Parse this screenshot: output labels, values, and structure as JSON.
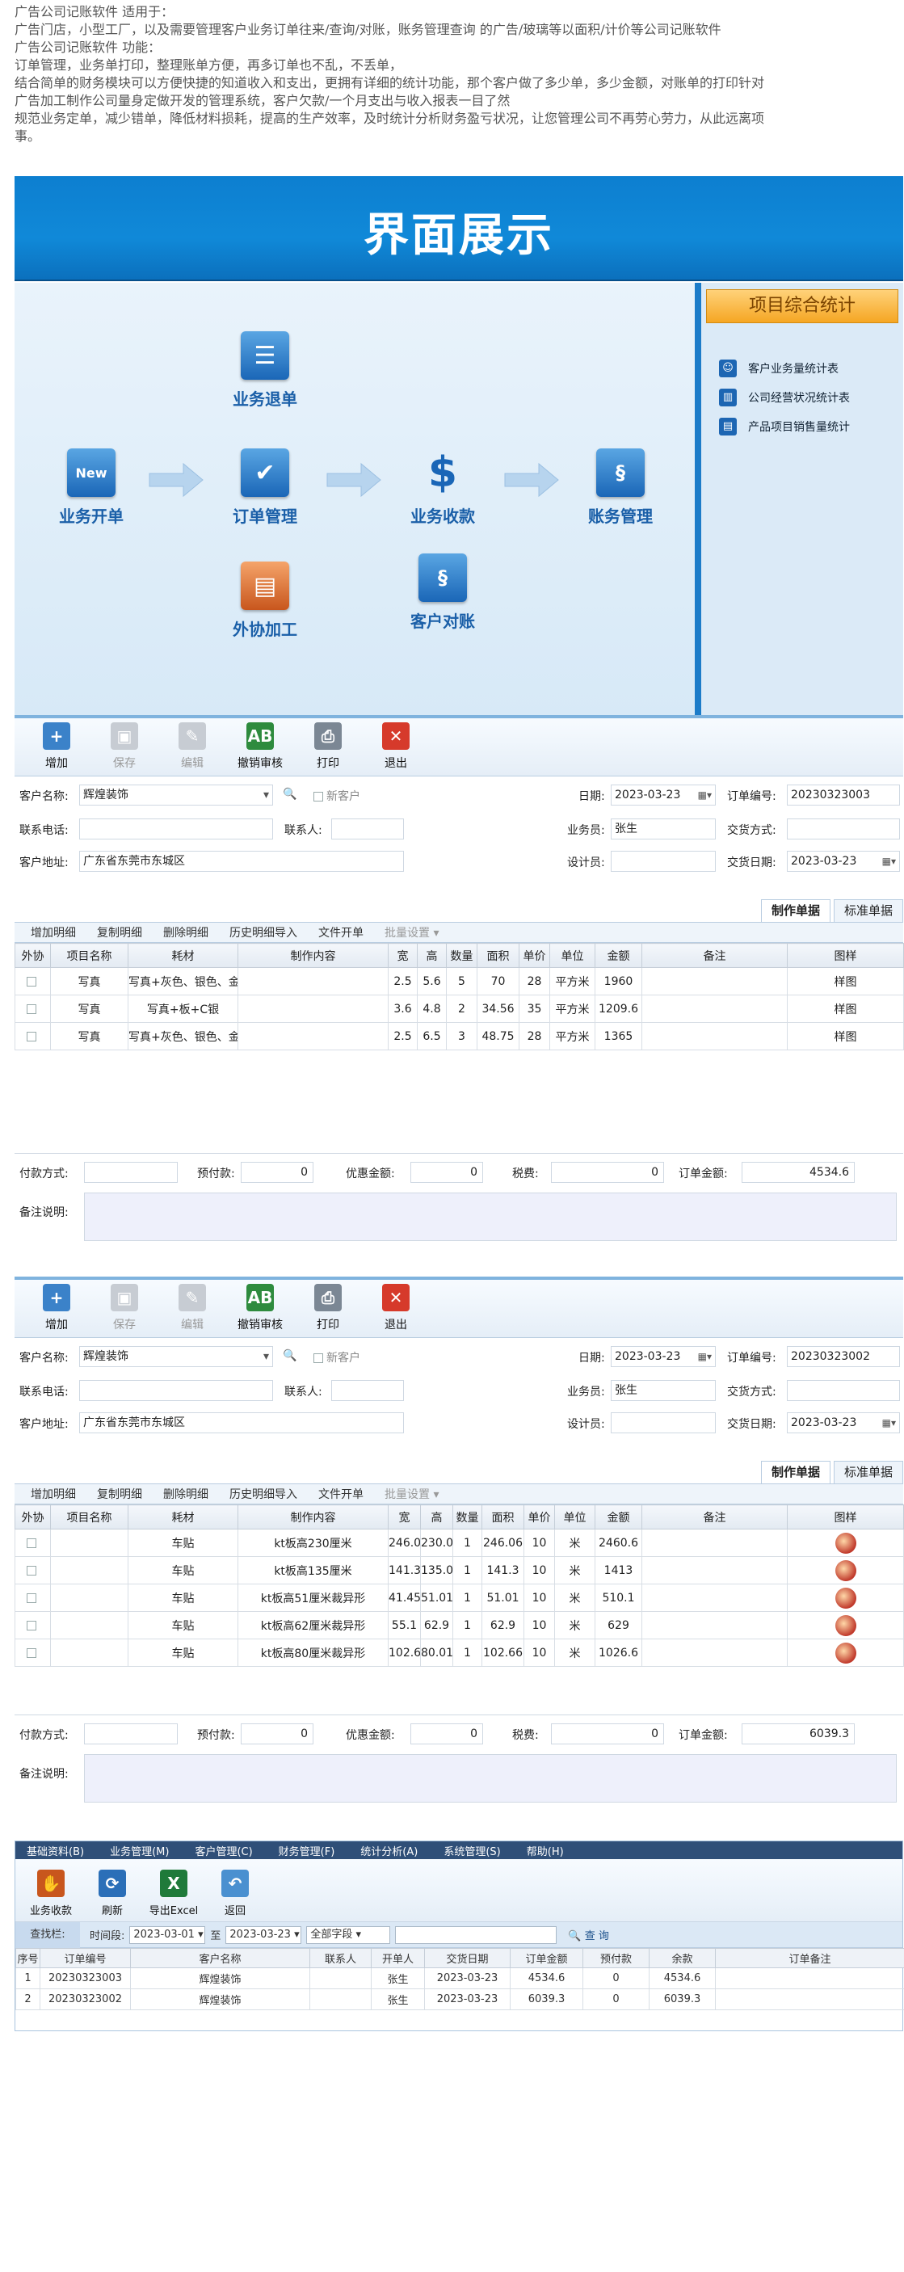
{
  "intro": {
    "lines": [
      "广告公司记账软件 适用于：",
      "广告门店，小型工厂，以及需要管理客户业务订单往来/查询/对账，账务管理查询 的广告/玻璃等以面积/计价等公司记账软件",
      "广告公司记账软件 功能：",
      "订单管理，业务单打印，整理账单方便，再多订单也不乱，不丢单，",
      "结合简单的财务模块可以方便快捷的知道收入和支出，更拥有详细的统计功能，那个客户做了多少单，多少金额，对账单的打印针对",
      "广告加工制作公司量身定做开发的管理系统，客户欠款/一个月支出与收入报表一目了然",
      "规范业务定单，减少错单，降低材料损耗，提高的生产效率，及时统计分析财务盈亏状况，让您管理公司不再劳心劳力，从此远离项",
      "事。"
    ]
  },
  "banner": {
    "title": "界面展示"
  },
  "flow": {
    "nodes": {
      "refund": "业务退单",
      "new_order": "业务开单",
      "order_mgmt": "订单管理",
      "collection": "业务收款",
      "accounts": "账务管理",
      "outsource": "外协加工",
      "reconcile": "客户对账"
    },
    "new_icon_text": "New"
  },
  "stats": {
    "title": "项目综合统计",
    "items": [
      "客户业务量统计表",
      "公司经营状况统计表",
      "产品项目销售量统计"
    ]
  },
  "toolbar": {
    "add": "增加",
    "save": "保存",
    "edit": "编辑",
    "audit": "撤销审核",
    "print": "打印",
    "exit": "退出"
  },
  "labels": {
    "customer": "客户名称:",
    "new_customer": "新客户",
    "date": "日期:",
    "order_no": "订单编号:",
    "phone": "联系电话:",
    "contact": "联系人:",
    "salesman": "业务员:",
    "delivery_method": "交货方式:",
    "address": "客户地址:",
    "designer": "设计员:",
    "delivery_date": "交货日期:",
    "tab_detail": "制作单据",
    "tab_standard": "标准单据",
    "sub_add": "增加明细",
    "sub_copy": "复制明细",
    "sub_delete": "删除明细",
    "sub_import": "历史明细导入",
    "sub_file": "文件开单",
    "sub_batch": "批量设置 ▾",
    "pay_method": "付款方式:",
    "prepaid": "预付款:",
    "discount": "优惠金额:",
    "tax": "税费:",
    "total": "订单金额:",
    "remark": "备注说明:"
  },
  "columns": [
    "外协",
    "项目名称",
    "耗材",
    "制作内容",
    "宽",
    "高",
    "数量",
    "面积",
    "单价",
    "单位",
    "金额",
    "备注",
    "图样"
  ],
  "order1": {
    "customer": "辉煌装饰",
    "date": "2023-03-23",
    "order_no": "20230323003",
    "salesman": "张生",
    "address": "广东省东莞市东城区",
    "delivery_date": "2023-03-23",
    "prepaid": "0",
    "discount": "0",
    "tax": "0",
    "total": "4534.6",
    "rows": [
      [
        "",
        "写真",
        "写真+灰色、银色、金",
        "",
        "2.5",
        "5.6",
        "5",
        "70",
        "28",
        "平方米",
        "1960",
        "",
        "样图"
      ],
      [
        "",
        "写真",
        "写真+板+C银",
        "",
        "3.6",
        "4.8",
        "2",
        "34.56",
        "35",
        "平方米",
        "1209.6",
        "",
        "样图"
      ],
      [
        "",
        "写真",
        "写真+灰色、银色、金",
        "",
        "2.5",
        "6.5",
        "3",
        "48.75",
        "28",
        "平方米",
        "1365",
        "",
        "样图"
      ]
    ]
  },
  "order2": {
    "customer": "辉煌装饰",
    "date": "2023-03-23",
    "order_no": "20230323002",
    "salesman": "张生",
    "address": "广东省东莞市东城区",
    "delivery_date": "2023-03-23",
    "prepaid": "0",
    "discount": "0",
    "tax": "0",
    "total": "6039.3",
    "rows": [
      [
        "",
        "",
        "车贴",
        "kt板高230厘米",
        "246.0",
        "230.0",
        "1",
        "246.06",
        "10",
        "米",
        "2460.6",
        "",
        ""
      ],
      [
        "",
        "",
        "车贴",
        "kt板高135厘米",
        "141.3",
        "135.0",
        "1",
        "141.3",
        "10",
        "米",
        "1413",
        "",
        ""
      ],
      [
        "",
        "",
        "车贴",
        "kt板高51厘米裁异形",
        "41.45",
        "51.01",
        "1",
        "51.01",
        "10",
        "米",
        "510.1",
        "",
        ""
      ],
      [
        "",
        "",
        "车贴",
        "kt板高62厘米裁异形",
        "55.1",
        "62.9",
        "1",
        "62.9",
        "10",
        "米",
        "629",
        "",
        ""
      ],
      [
        "",
        "",
        "车贴",
        "kt板高80厘米裁异形",
        "102.6",
        "80.01",
        "1",
        "102.66",
        "10",
        "米",
        "1026.6",
        "",
        ""
      ]
    ]
  },
  "listwin": {
    "menu": [
      "基础资料(B)",
      "业务管理(M)",
      "客户管理(C)",
      "财务管理(F)",
      "统计分析(A)",
      "系统管理(S)",
      "帮助(H)"
    ],
    "tools": {
      "collect": "业务收款",
      "refresh": "刷新",
      "export": "导出Excel",
      "back": "返回"
    },
    "query": {
      "label": "查找栏:",
      "period": "时间段:",
      "from": "2023-03-01",
      "to_word": "至",
      "to": "2023-03-23",
      "field": "全部字段",
      "search": "查 询"
    },
    "columns": [
      "序号",
      "订单编号",
      "客户名称",
      "联系人",
      "开单人",
      "交货日期",
      "订单金额",
      "预付款",
      "余款",
      "订单备注"
    ],
    "rows": [
      [
        "1",
        "20230323003",
        "辉煌装饰",
        "",
        "张生",
        "2023-03-23",
        "4534.6",
        "0",
        "4534.6",
        ""
      ],
      [
        "2",
        "20230323002",
        "辉煌装饰",
        "",
        "张生",
        "2023-03-23",
        "6039.3",
        "0",
        "6039.3",
        ""
      ]
    ]
  }
}
